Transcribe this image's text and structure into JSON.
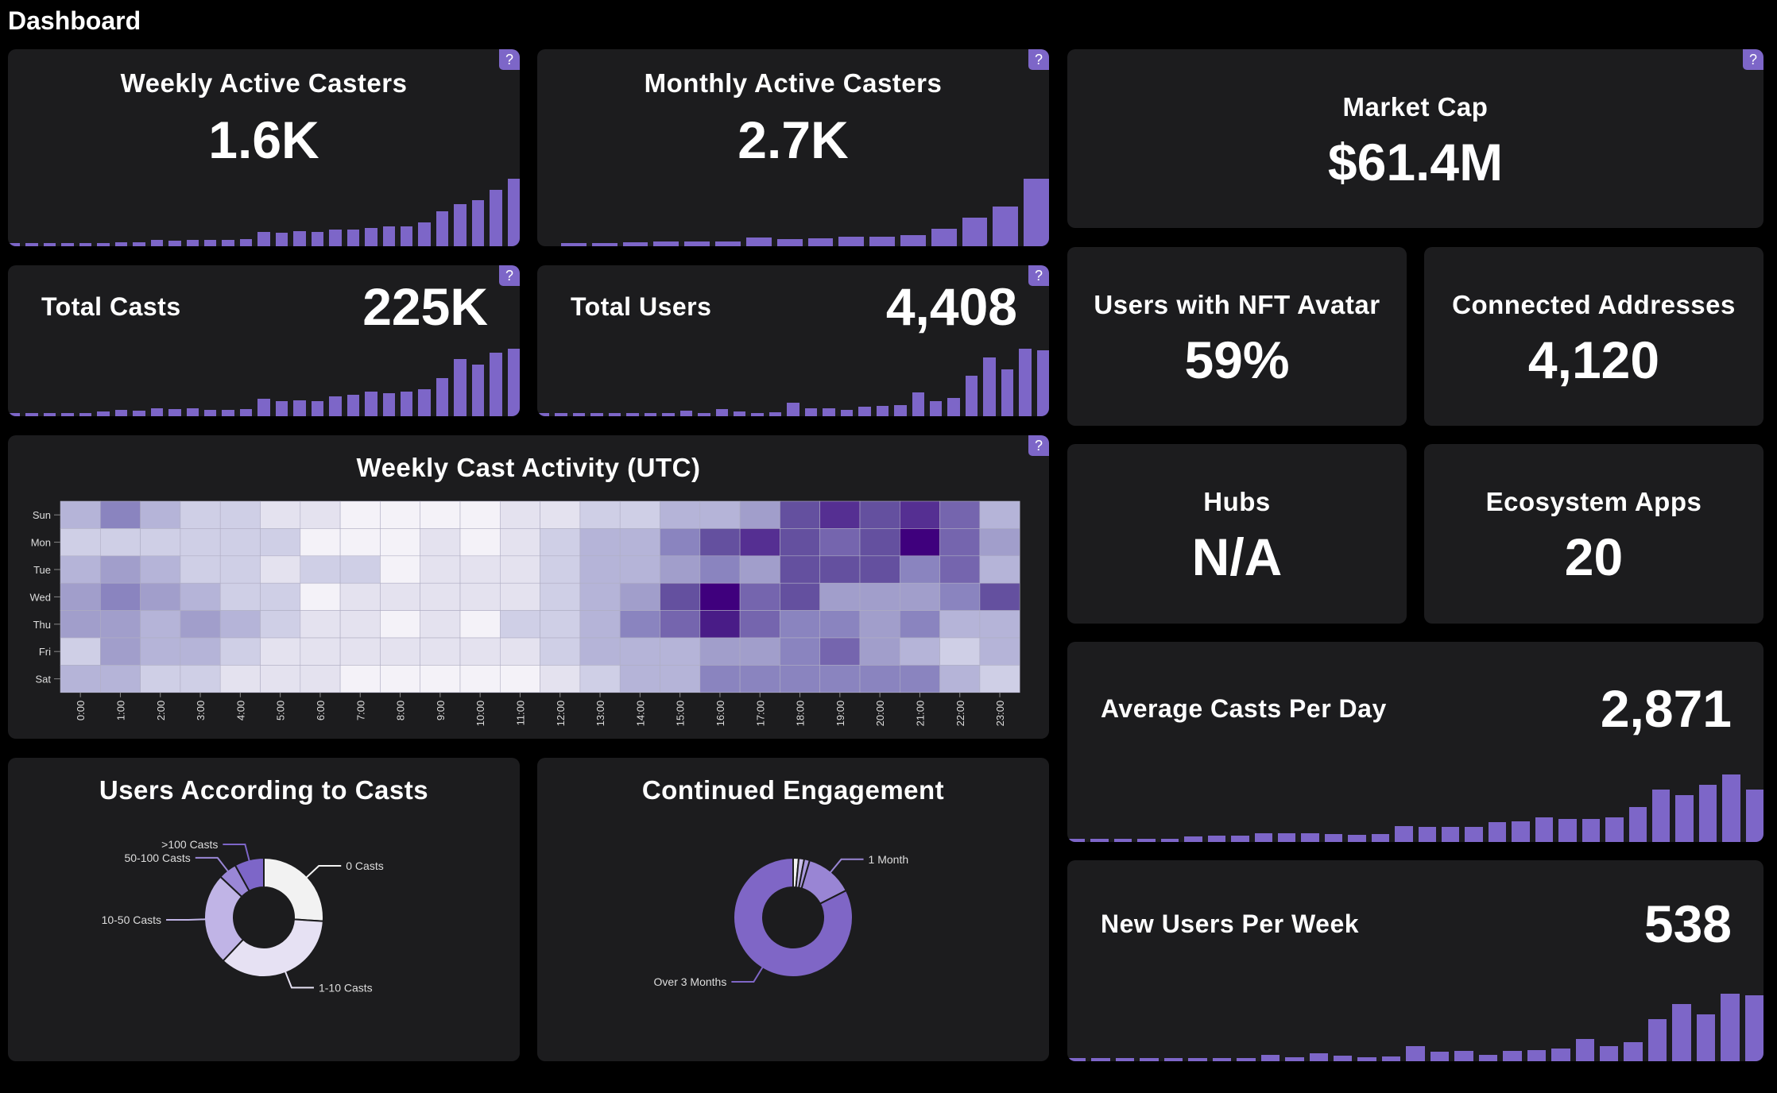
{
  "page_title": "Dashboard",
  "help_label": "?",
  "accent": "#7d66c8",
  "cards": {
    "weekly_active": {
      "title": "Weekly Active Casters",
      "value": "1.6K",
      "bars": [
        4,
        3,
        3,
        4,
        4,
        4,
        6,
        6,
        9,
        8,
        10,
        10,
        10,
        11,
        21,
        20,
        22,
        21,
        25,
        25,
        27,
        30,
        30,
        35,
        52,
        62,
        68,
        84,
        100
      ]
    },
    "monthly_active": {
      "title": "Monthly Active Casters",
      "value": "2.7K",
      "bars": [
        1,
        1,
        6,
        7,
        7,
        7,
        13,
        11,
        12,
        14,
        14,
        16,
        26,
        42,
        59,
        100
      ]
    },
    "total_casts": {
      "title": "Total Casts",
      "value": "225K",
      "bars": [
        4,
        3,
        3,
        4,
        4,
        7,
        9,
        8,
        12,
        11,
        12,
        10,
        9,
        11,
        26,
        22,
        24,
        22,
        30,
        32,
        36,
        34,
        36,
        40,
        56,
        85,
        76,
        94,
        100
      ]
    },
    "total_users": {
      "title": "Total Users",
      "value": "4,408",
      "bars": [
        2,
        0,
        1,
        2,
        0,
        0,
        4,
        4,
        8,
        4,
        11,
        7,
        4,
        6,
        20,
        12,
        12,
        9,
        14,
        15,
        17,
        35,
        22,
        27,
        60,
        87,
        70,
        100,
        98
      ]
    },
    "market_cap": {
      "title": "Market Cap",
      "value": "$61.4M"
    },
    "nft_avatar": {
      "title": "Users with NFT Avatar",
      "value": "59%"
    },
    "connected": {
      "title": "Connected Addresses",
      "value": "4,120"
    },
    "hubs": {
      "title": "Hubs",
      "value": "N/A"
    },
    "apps": {
      "title": "Ecosystem Apps",
      "value": "20"
    },
    "avg_casts": {
      "title": "Average Casts Per Day",
      "value": "2,871",
      "bars": [
        4,
        4,
        4,
        4,
        4,
        8,
        9,
        9,
        13,
        13,
        13,
        12,
        11,
        12,
        23,
        22,
        22,
        22,
        29,
        31,
        36,
        34,
        34,
        37,
        52,
        78,
        70,
        85,
        100,
        78
      ]
    },
    "new_users": {
      "title": "New Users Per Week",
      "value": "538",
      "bars": [
        3,
        1,
        1,
        3,
        0,
        1,
        5,
        4,
        10,
        6,
        12,
        8,
        6,
        7,
        22,
        14,
        15,
        10,
        15,
        16,
        19,
        33,
        22,
        28,
        62,
        85,
        69,
        100,
        98
      ]
    }
  },
  "chart_data": [
    {
      "type": "heatmap",
      "title": "Weekly Cast Activity (UTC)",
      "y_categories": [
        "Sun",
        "Mon",
        "Tue",
        "Wed",
        "Thu",
        "Fri",
        "Sat"
      ],
      "x_categories": [
        "0:00",
        "1:00",
        "2:00",
        "3:00",
        "4:00",
        "5:00",
        "6:00",
        "7:00",
        "8:00",
        "9:00",
        "10:00",
        "11:00",
        "12:00",
        "13:00",
        "14:00",
        "15:00",
        "16:00",
        "17:00",
        "18:00",
        "19:00",
        "20:00",
        "21:00",
        "22:00",
        "23:00"
      ],
      "color_scale": [
        "#f4f2f8",
        "#3f007d"
      ],
      "values": [
        [
          3,
          5,
          3,
          2,
          2,
          1,
          1,
          0,
          0,
          0,
          0,
          1,
          1,
          2,
          2,
          3,
          3,
          4,
          7,
          8,
          7,
          8,
          6,
          3
        ],
        [
          2,
          2,
          2,
          2,
          2,
          2,
          0,
          0,
          0,
          1,
          0,
          1,
          2,
          3,
          3,
          5,
          7,
          8,
          7,
          6,
          7,
          10,
          6,
          4
        ],
        [
          3,
          4,
          3,
          2,
          2,
          1,
          2,
          2,
          0,
          1,
          1,
          1,
          2,
          3,
          3,
          4,
          5,
          4,
          7,
          7,
          7,
          5,
          6,
          3
        ],
        [
          4,
          5,
          4,
          3,
          2,
          2,
          0,
          1,
          1,
          1,
          1,
          1,
          2,
          3,
          4,
          7,
          10,
          6,
          7,
          4,
          4,
          4,
          5,
          7
        ],
        [
          4,
          4,
          3,
          4,
          3,
          2,
          1,
          1,
          0,
          1,
          0,
          2,
          2,
          3,
          5,
          6,
          9,
          6,
          5,
          5,
          4,
          5,
          3,
          3
        ],
        [
          2,
          4,
          3,
          3,
          2,
          1,
          1,
          1,
          1,
          1,
          1,
          1,
          2,
          3,
          3,
          3,
          4,
          4,
          5,
          6,
          4,
          3,
          2,
          3
        ],
        [
          3,
          3,
          2,
          2,
          1,
          1,
          1,
          0,
          0,
          0,
          0,
          0,
          1,
          2,
          3,
          3,
          5,
          5,
          5,
          5,
          5,
          5,
          3,
          2
        ]
      ]
    },
    {
      "type": "pie",
      "title": "Users According to Casts",
      "slices": [
        {
          "name": "0 Casts",
          "value": 26,
          "color": "#f2f2f2"
        },
        {
          "name": "1-10 Casts",
          "value": 36,
          "color": "#e6e1f3"
        },
        {
          "name": "10-50 Casts",
          "value": 25,
          "color": "#c0b4e6"
        },
        {
          "name": "50-100 Casts",
          "value": 5,
          "color": "#9a87d6"
        },
        {
          "name": ">100 Casts",
          "value": 8,
          "color": "#7d66c8"
        }
      ]
    },
    {
      "type": "pie",
      "title": "Continued Engagement",
      "slices": [
        {
          "name": "",
          "value": 1.5,
          "color": "#f2f2f2"
        },
        {
          "name": "",
          "value": 1.5,
          "color": "#c8bde9"
        },
        {
          "name": "",
          "value": 1.5,
          "color": "#a898dc"
        },
        {
          "name": "1 Month",
          "value": 13,
          "color": "#9985d4"
        },
        {
          "name": "Over 3 Months",
          "value": 82.5,
          "color": "#7f66c6"
        }
      ]
    }
  ]
}
